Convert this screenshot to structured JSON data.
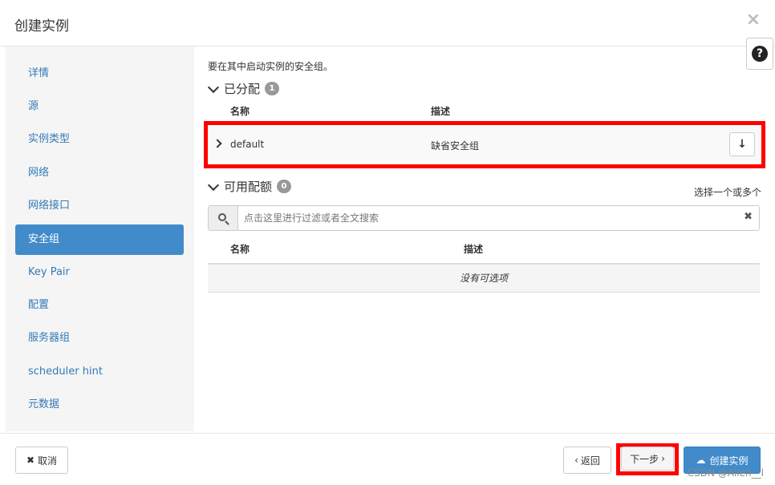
{
  "dialog": {
    "title": "创建实例",
    "close_glyph": "×",
    "help_glyph": "?"
  },
  "sidebar": {
    "items": [
      {
        "label": "详情"
      },
      {
        "label": "源"
      },
      {
        "label": "实例类型"
      },
      {
        "label": "网络"
      },
      {
        "label": "网络接口"
      },
      {
        "label": "安全组",
        "active": true
      },
      {
        "label": "Key Pair"
      },
      {
        "label": "配置"
      },
      {
        "label": "服务器组"
      },
      {
        "label": "scheduler hint"
      },
      {
        "label": "元数据"
      }
    ]
  },
  "main": {
    "intro": "要在其中启动实例的安全组。",
    "allocated": {
      "title": "已分配",
      "count": "1",
      "col_name": "名称",
      "col_desc": "描述",
      "rows": [
        {
          "name": "default",
          "desc": "缺省安全组"
        }
      ]
    },
    "available": {
      "title": "可用配额",
      "count": "0",
      "pick_hint": "选择一个或多个",
      "search_placeholder": "点击这里进行过滤或者全文搜索",
      "col_name": "名称",
      "col_desc": "描述",
      "empty_text": "没有可选项"
    }
  },
  "footer": {
    "cancel_label": "取消",
    "back_label": "返回",
    "next_label": "下一步",
    "create_label": "创建实例",
    "watermark": "CSDN @Allen__l"
  },
  "colors": {
    "accent": "#428bca",
    "highlight_box": "#ff0000"
  }
}
